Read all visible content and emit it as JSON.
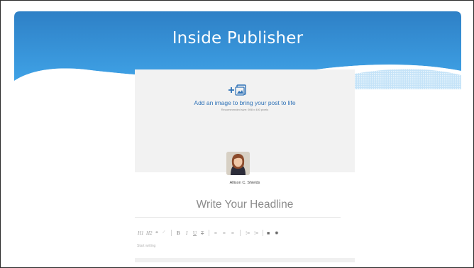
{
  "slide": {
    "title": "Inside Publisher"
  },
  "publisher": {
    "add_image_text": "Add an image to bring your post to life",
    "recommended_text": "Recommended size: 698 x 400 pixels",
    "author_name": "Allison C. Shields",
    "headline_placeholder": "Write Your Headline",
    "body_placeholder": "Start writing",
    "toolbar": {
      "h1": "H1",
      "h2": "H2",
      "quote": "❝",
      "link": "🔗",
      "bold": "B",
      "italic": "I",
      "underline": "U",
      "strike": "T"
    }
  },
  "colors": {
    "header_blue": "#2f8bd4",
    "link_blue": "#2f72b7",
    "placeholder_gray": "#8c8c8c"
  },
  "icons": [
    "add-image-icon",
    "camera-icon",
    "gear-icon",
    "align-left-icon",
    "align-center-icon",
    "align-right-icon",
    "bullet-list-icon",
    "number-list-icon"
  ]
}
